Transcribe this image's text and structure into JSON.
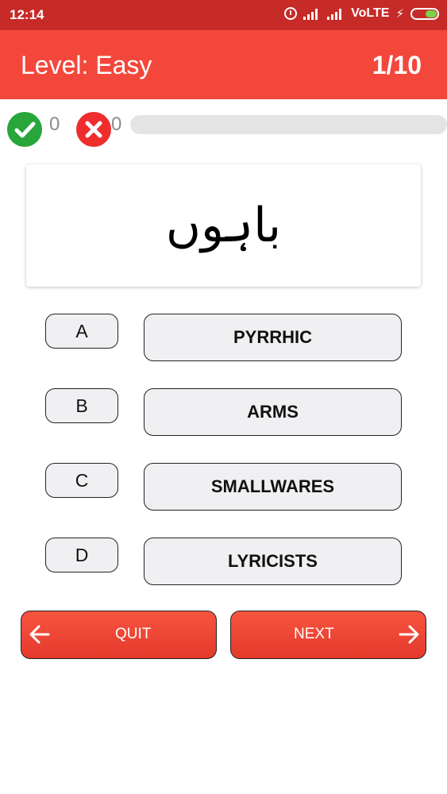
{
  "status_bar": {
    "time": "12:14",
    "network": "VoLTE",
    "icons": [
      "alarm-icon",
      "signal-icon",
      "signal-icon",
      "charging-bolt-icon",
      "battery-icon"
    ]
  },
  "header": {
    "level_text": "Level: Easy",
    "question_counter": "1/10"
  },
  "score": {
    "correct_count": "0",
    "wrong_count": "0",
    "progress_fraction": 0,
    "correct_icon": "check-circle-icon",
    "wrong_icon": "x-circle-icon"
  },
  "question": {
    "word": "باہوں"
  },
  "options": [
    {
      "letter": "A",
      "answer": "PYRRHIC"
    },
    {
      "letter": "B",
      "answer": "ARMS"
    },
    {
      "letter": "C",
      "answer": "SMALLWARES"
    },
    {
      "letter": "D",
      "answer": "LYRICISTS"
    }
  ],
  "buttons": {
    "quit_label": "QUIT",
    "next_label": "NEXT",
    "quit_icon": "arrow-left-icon",
    "next_icon": "arrow-right-icon"
  },
  "colors": {
    "status_bar": "#c62b27",
    "app_bar": "#f4473c",
    "correct": "#28a53b",
    "wrong": "#ef2d2d",
    "button": "#f04a38"
  }
}
